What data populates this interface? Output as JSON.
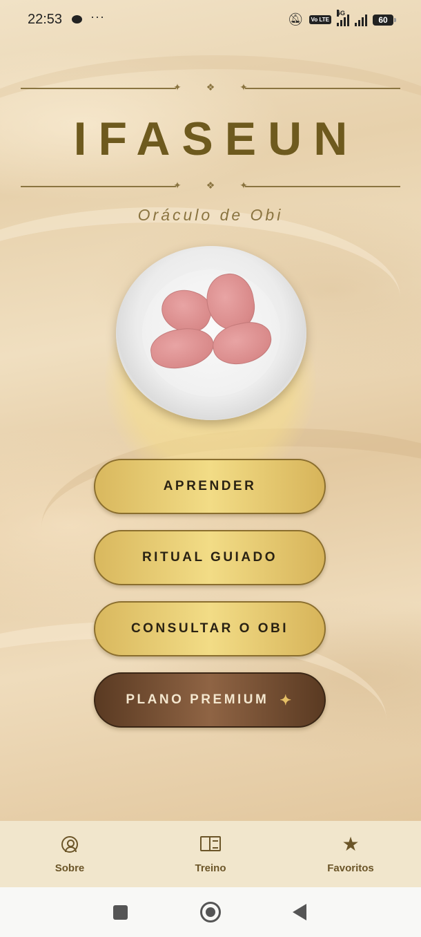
{
  "status_bar": {
    "time": "22:53",
    "battery": "60",
    "network_label": "5G",
    "volte_label": "Vo LTE"
  },
  "header": {
    "title": "IFASEUN",
    "subtitle": "Oráculo de Obi",
    "ornament": "✦ ❖ ✦"
  },
  "hero": {
    "image_alt": "obi-kola-nut-plate"
  },
  "menu": {
    "aprender": "APRENDER",
    "ritual_guiado": "RITUAL GUIADO",
    "consultar": "CONSULTAR O OBI",
    "premium": "PLANO PREMIUM",
    "premium_icon": "✦"
  },
  "bottom_nav": {
    "sobre": "Sobre",
    "treino": "Treino",
    "favoritos": "Favoritos"
  },
  "colors": {
    "title": "#6e5a1e",
    "gold_button": "#f2dc86",
    "premium_button": "#8f6444",
    "nav_text": "#6b5528"
  }
}
